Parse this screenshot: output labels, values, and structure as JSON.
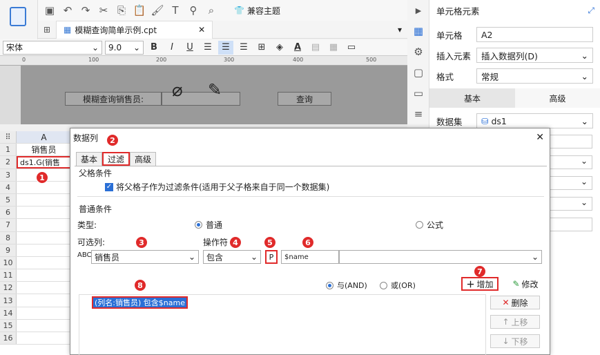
{
  "toolbar": {
    "compat_theme": "兼容主题"
  },
  "tab": {
    "file_name": "模糊查询简单示例.cpt"
  },
  "format": {
    "font_name": "宋体",
    "font_size": "9.0",
    "bold": "B",
    "italic": "I",
    "underline": "U"
  },
  "ruler": {
    "ticks": [
      "0",
      "100",
      "200",
      "300",
      "400",
      "500"
    ]
  },
  "canvas": {
    "label": "模糊查询销售员:",
    "query_button": "查询"
  },
  "grid": {
    "col_header": "A",
    "rows": [
      {
        "num": "1",
        "value": "销售员"
      },
      {
        "num": "2",
        "value": "ds1.G(销售"
      },
      {
        "num": "3",
        "value": ""
      },
      {
        "num": "4",
        "value": ""
      },
      {
        "num": "5",
        "value": ""
      },
      {
        "num": "6",
        "value": ""
      },
      {
        "num": "7",
        "value": ""
      },
      {
        "num": "8",
        "value": ""
      },
      {
        "num": "9",
        "value": ""
      },
      {
        "num": "10",
        "value": ""
      },
      {
        "num": "11",
        "value": ""
      },
      {
        "num": "12",
        "value": ""
      },
      {
        "num": "13",
        "value": ""
      },
      {
        "num": "14",
        "value": ""
      },
      {
        "num": "15",
        "value": ""
      },
      {
        "num": "16",
        "value": ""
      }
    ]
  },
  "panel": {
    "title": "单元格元素",
    "cell_label": "单元格",
    "cell_value": "A2",
    "insert_label": "插入元素",
    "insert_value": "插入数据列(D)",
    "style_label": "格式",
    "style_value": "常规",
    "tab_basic": "基本",
    "tab_advanced": "高级",
    "dataset_label": "数据集",
    "dataset_value": "ds1"
  },
  "dialog": {
    "title": "数据列",
    "tabs": [
      "基本",
      "过滤",
      "高级"
    ],
    "parent_section": "父格条件",
    "parent_checkbox": "将父格子作为过滤条件(适用于父子格来自于同一个数据集)",
    "normal_section": "普通条件",
    "type_label": "类型:",
    "type_normal": "普通",
    "type_formula": "公式",
    "col_label": "可选列:",
    "col_value": "销售员",
    "op_label": "操作符",
    "op_value": "包含",
    "param_button": "P",
    "param_value": "$name",
    "and_label": "与(AND)",
    "or_label": "或(OR)",
    "add_button": "增加",
    "modify_button": "修改",
    "delete_button": "删除",
    "up_button": "上移",
    "down_button": "下移",
    "condition": "(列名:销售员) 包含$name"
  },
  "badges": [
    "1",
    "2",
    "3",
    "4",
    "5",
    "6",
    "7",
    "8"
  ],
  "colors": {
    "accent": "#e02a2a",
    "selection": "#2a6fd6"
  }
}
